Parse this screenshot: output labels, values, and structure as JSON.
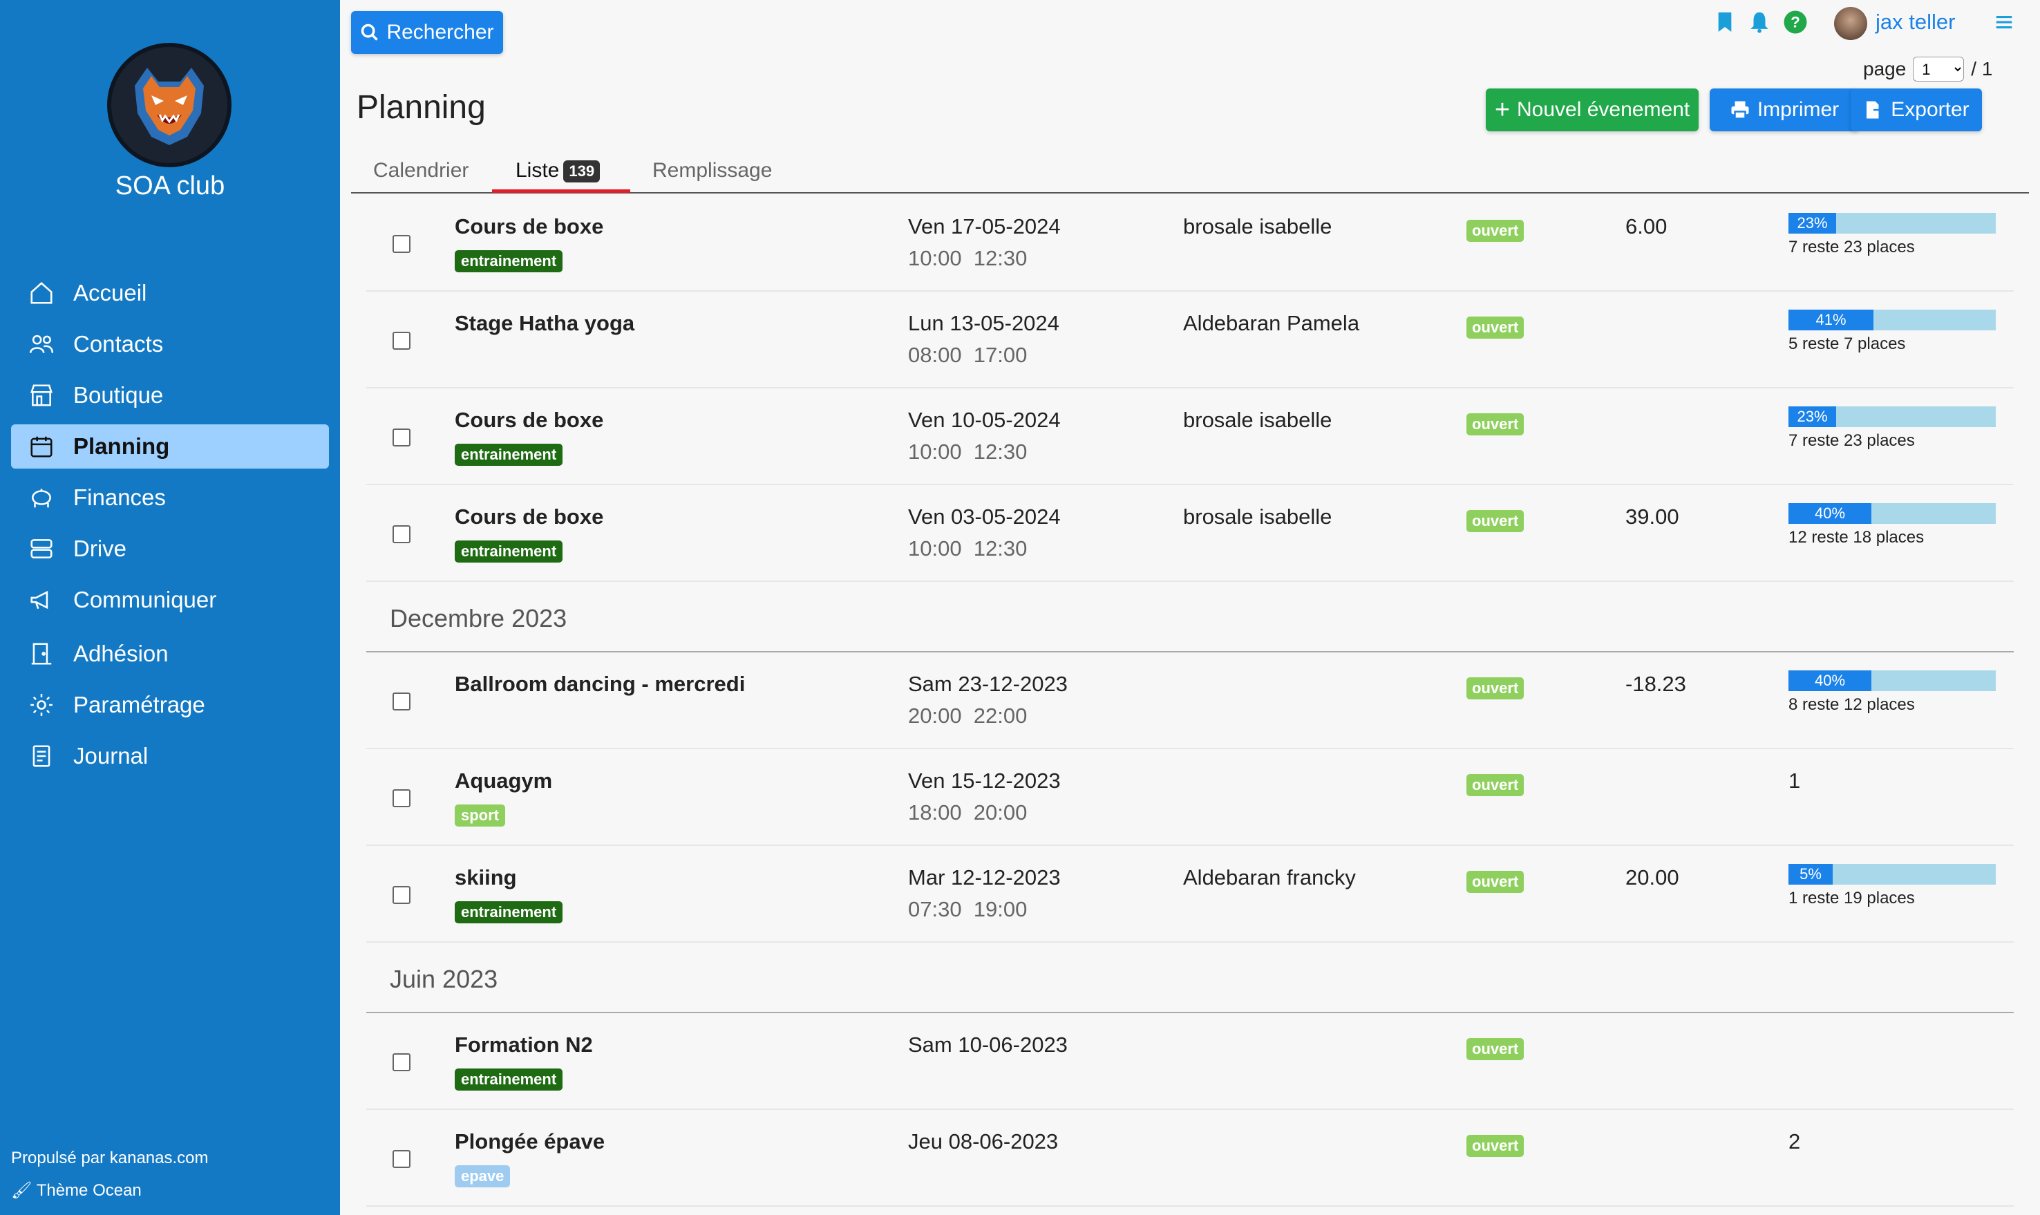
{
  "sidebar": {
    "club_name": "SOA club",
    "items": [
      {
        "label": "Accueil",
        "icon": "home-icon"
      },
      {
        "label": "Contacts",
        "icon": "users-icon"
      },
      {
        "label": "Boutique",
        "icon": "store-icon"
      },
      {
        "label": "Planning",
        "icon": "calendar-icon",
        "active": true
      },
      {
        "label": "Finances",
        "icon": "piggy-bank-icon"
      },
      {
        "label": "Drive",
        "icon": "server-icon"
      },
      {
        "label": "Communiquer",
        "icon": "megaphone-icon"
      },
      {
        "label": "Adhésion",
        "icon": "door-icon"
      },
      {
        "label": "Paramétrage",
        "icon": "gear-icon"
      },
      {
        "label": "Journal",
        "icon": "document-icon"
      }
    ],
    "footer_powered": "Propulsé par kananas.com",
    "footer_theme": "Thème Ocean"
  },
  "topbar": {
    "search_label": "Rechercher",
    "username": "jax teller",
    "page_label": "page",
    "page_current": "1",
    "page_total": "/ 1"
  },
  "main": {
    "title": "Planning",
    "buttons": {
      "new_event": "Nouvel évenement",
      "print": "Imprimer",
      "export": "Exporter"
    },
    "tabs": [
      {
        "label": "Calendrier"
      },
      {
        "label": "Liste",
        "badge": "139"
      },
      {
        "label": "Remplissage"
      }
    ]
  },
  "events": [
    {
      "title": "Cours de boxe",
      "tag": "entrainement",
      "date": "Ven 17-05-2024",
      "time": "10:00  12:30",
      "person": "brosale isabelle",
      "status": "ouvert",
      "amount": "6.00",
      "fill_pct": "23%",
      "fill": 0.23,
      "places": "7 reste 23 places"
    },
    {
      "title": "Stage Hatha yoga",
      "tag": "",
      "date": "Lun 13-05-2024",
      "time": "08:00  17:00",
      "person": "Aldebaran Pamela",
      "status": "ouvert",
      "amount": "",
      "fill_pct": "41%",
      "fill": 0.41,
      "places": "5 reste 7 places"
    },
    {
      "title": "Cours de boxe",
      "tag": "entrainement",
      "date": "Ven 10-05-2024",
      "time": "10:00  12:30",
      "person": "brosale isabelle",
      "status": "ouvert",
      "amount": "",
      "fill_pct": "23%",
      "fill": 0.23,
      "places": "7 reste 23 places"
    },
    {
      "title": "Cours de boxe",
      "tag": "entrainement",
      "date": "Ven 03-05-2024",
      "time": "10:00  12:30",
      "person": "brosale isabelle",
      "status": "ouvert",
      "amount": "39.00",
      "fill_pct": "40%",
      "fill": 0.4,
      "places": "12 reste 18 places"
    },
    {
      "month": "Decembre 2023"
    },
    {
      "title": "Ballroom dancing - mercredi",
      "tag": "",
      "date": "Sam 23-12-2023",
      "time": "20:00  22:00",
      "person": "",
      "status": "ouvert",
      "amount": "-18.23",
      "fill_pct": "40%",
      "fill": 0.4,
      "places": "8 reste 12 places"
    },
    {
      "title": "Aquagym",
      "tag": "sport",
      "date": "Ven 15-12-2023",
      "time": "18:00  20:00",
      "person": "",
      "status": "ouvert",
      "amount": "",
      "count": "1"
    },
    {
      "title": "skiing",
      "tag": "entrainement",
      "date": "Mar 12-12-2023",
      "time": "07:30  19:00",
      "person": "Aldebaran francky",
      "status": "ouvert",
      "amount": "20.00",
      "fill_pct": "5%",
      "fill": 0.05,
      "places": "1 reste 19 places"
    },
    {
      "month": "Juin 2023"
    },
    {
      "title": "Formation N2",
      "tag": "entrainement",
      "date": "Sam 10-06-2023",
      "time": "",
      "person": "",
      "status": "ouvert",
      "amount": ""
    },
    {
      "title": "Plongée épave",
      "tag": "epave",
      "date": "Jeu 08-06-2023",
      "time": "",
      "person": "",
      "status": "ouvert",
      "amount": "",
      "count": "2"
    }
  ],
  "colors": {
    "sidebar": "#1479c4",
    "primary": "#1a82e8",
    "success": "#20a84b",
    "tag_dark": "#1f6b14",
    "tag_light": "#8ecf5e",
    "tab_active": "#e0202a"
  }
}
